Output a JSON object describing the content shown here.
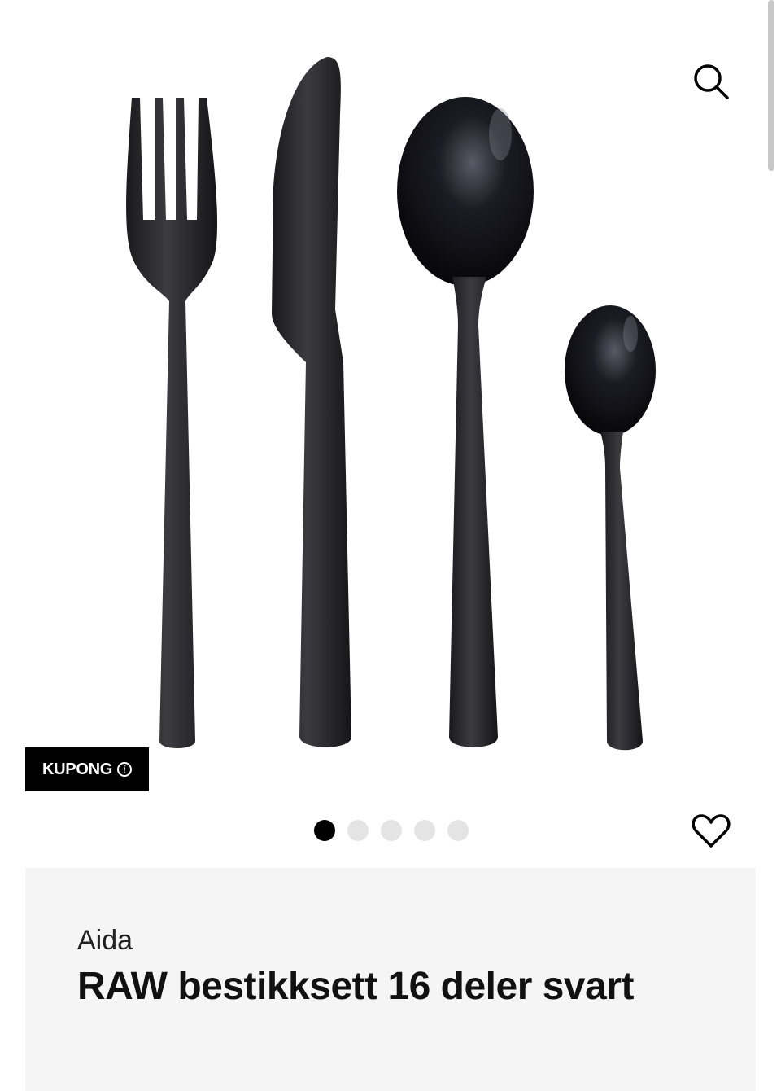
{
  "product": {
    "brand": "Aida",
    "title": "RAW bestikksett 16 deler svart",
    "image_alt": "Black cutlery set: fork, knife, spoon and teaspoon"
  },
  "gallery": {
    "dots": [
      {
        "active": true
      },
      {
        "active": false
      },
      {
        "active": false
      },
      {
        "active": false
      },
      {
        "active": false
      }
    ]
  },
  "badge": {
    "label": "KUPONG",
    "info_glyph": "i"
  },
  "icons": {
    "search": "search-icon",
    "favorite": "heart-outline-icon",
    "info": "info-icon"
  },
  "colors": {
    "badge_bg": "#000000",
    "panel_bg": "#f5f5f5",
    "dot_active": "#000000",
    "dot_inactive": "#e4e4e4"
  }
}
